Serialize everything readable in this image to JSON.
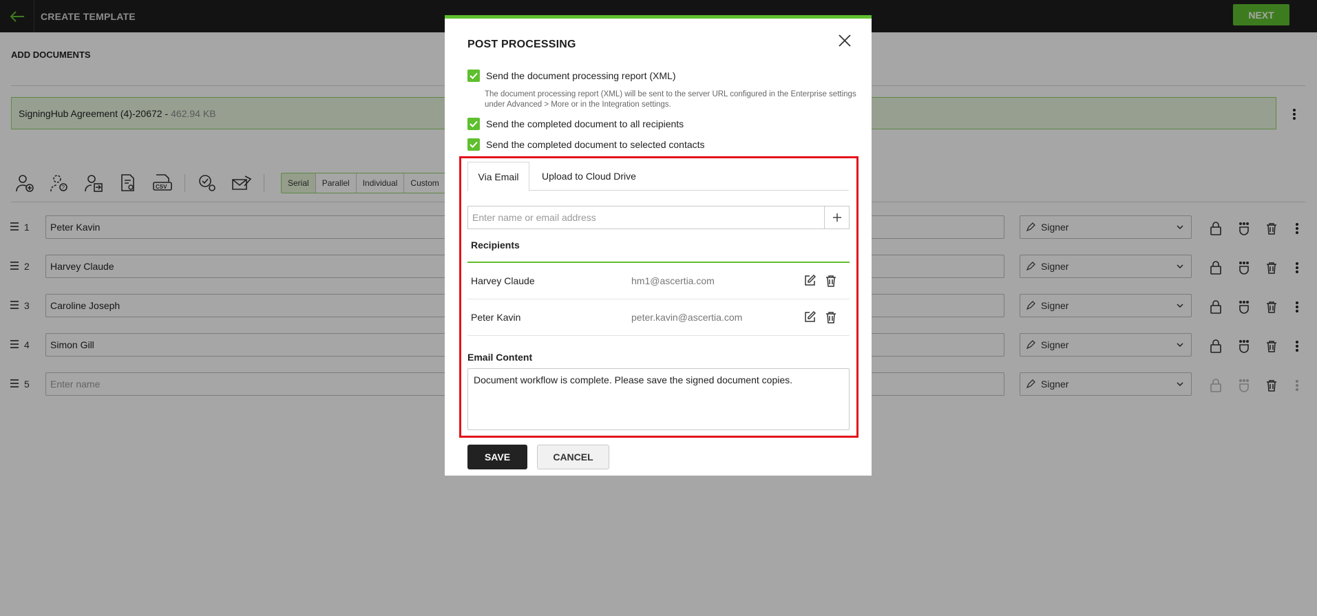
{
  "header": {
    "title": "CREATE TEMPLATE",
    "next_label": "NEXT"
  },
  "page": {
    "section_title": "ADD DOCUMENTS",
    "document": {
      "name": "SigningHub Agreement (4)-20672 -",
      "size": "462.94 KB"
    },
    "flow_modes": [
      {
        "label": "Serial",
        "active": true
      },
      {
        "label": "Parallel",
        "active": false
      },
      {
        "label": "Individual",
        "active": false
      },
      {
        "label": "Custom",
        "active": false
      }
    ],
    "recipients": [
      {
        "num": "1",
        "name": "Peter Kavin",
        "role": "Signer"
      },
      {
        "num": "2",
        "name": "Harvey Claude",
        "role": "Signer"
      },
      {
        "num": "3",
        "name": "Caroline Joseph",
        "role": "Signer"
      },
      {
        "num": "4",
        "name": "Simon Gill",
        "role": "Signer"
      },
      {
        "num": "5",
        "name": "",
        "placeholder": "Enter name",
        "role": "Signer"
      }
    ]
  },
  "modal": {
    "title": "POST PROCESSING",
    "options": [
      {
        "label": "Send the document processing report (XML)",
        "checked": true
      },
      {
        "label": "Send the completed document to all recipients",
        "checked": true
      },
      {
        "label": "Send the completed document to selected contacts",
        "checked": true
      }
    ],
    "xml_note": "The document processing report (XML) will be sent to the server URL configured in the Enterprise settings under Advanced > More or in the Integration settings.",
    "tabs": [
      {
        "label": "Via Email",
        "active": true
      },
      {
        "label": "Upload to Cloud Drive",
        "active": false
      }
    ],
    "email_input_placeholder": "Enter name or email address",
    "recipients_heading": "Recipients",
    "recipients": [
      {
        "name": "Harvey Claude",
        "email": "hm1@ascertia.com"
      },
      {
        "name": "Peter Kavin",
        "email": "peter.kavin@ascertia.com"
      }
    ],
    "email_content_heading": "Email Content",
    "email_content": "Document workflow is complete. Please save the signed document copies.",
    "save_label": "SAVE",
    "cancel_label": "CANCEL"
  },
  "colors": {
    "accent": "#5fbf2e",
    "highlight": "#e3131b",
    "topbar": "#1e1e1e"
  }
}
